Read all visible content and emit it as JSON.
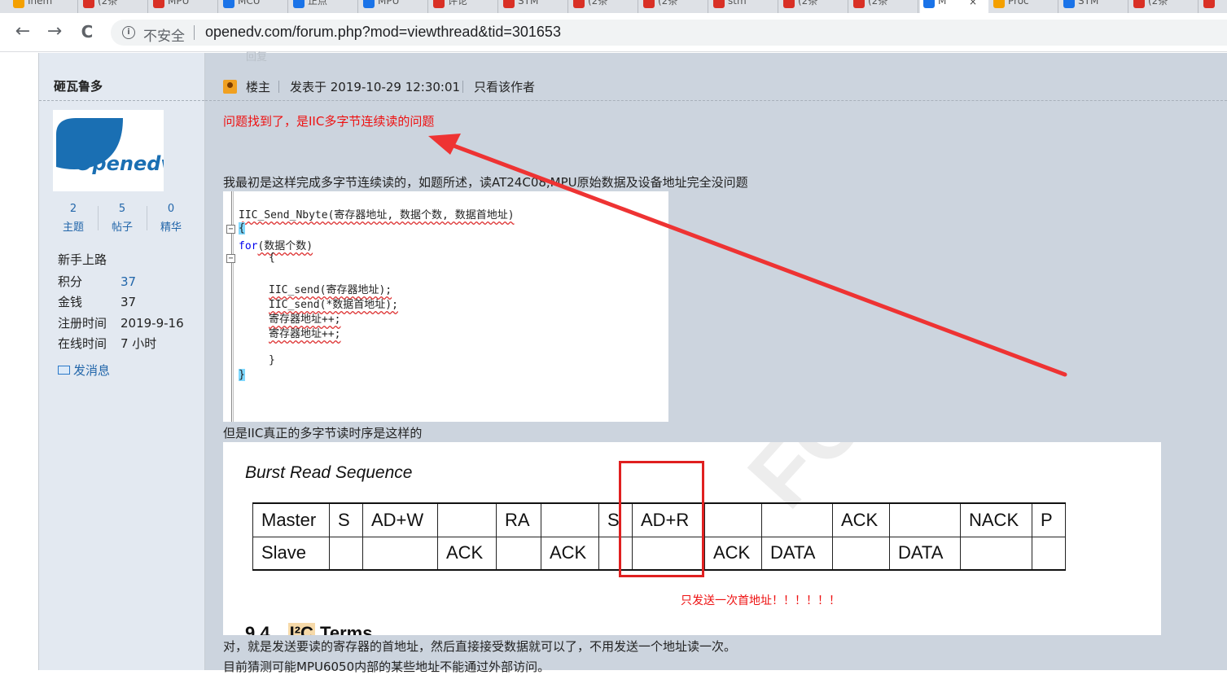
{
  "browser": {
    "tabs": [
      {
        "label": "Inem",
        "color": "#f4a000",
        "active": false
      },
      {
        "label": "(2条",
        "color": "#d93025",
        "active": false
      },
      {
        "label": "MPU",
        "color": "#d93025",
        "active": false
      },
      {
        "label": "MCU",
        "color": "#1a73e8",
        "active": false
      },
      {
        "label": "正点",
        "color": "#1a73e8",
        "active": false
      },
      {
        "label": "MPU",
        "color": "#1a73e8",
        "active": false
      },
      {
        "label": "评论",
        "color": "#d93025",
        "active": false
      },
      {
        "label": "STM",
        "color": "#d93025",
        "active": false
      },
      {
        "label": "(2条",
        "color": "#d93025",
        "active": false
      },
      {
        "label": "(2条",
        "color": "#d93025",
        "active": false
      },
      {
        "label": "stm",
        "color": "#d93025",
        "active": false
      },
      {
        "label": "(2条",
        "color": "#d93025",
        "active": false
      },
      {
        "label": "(2条",
        "color": "#d93025",
        "active": false
      },
      {
        "label": "M",
        "color": "#1a73e8",
        "active": true
      },
      {
        "label": "Proc",
        "color": "#f4a000",
        "active": false
      },
      {
        "label": "STM",
        "color": "#1a73e8",
        "active": false
      },
      {
        "label": "(2条",
        "color": "#d93025",
        "active": false
      },
      {
        "label": "",
        "color": "#d93025",
        "active": false
      }
    ],
    "close_glyph": "×",
    "nav": {
      "back": "←",
      "forward": "→",
      "reload": "C"
    },
    "security_label": "不安全",
    "url": "openedv.com/forum.php?mod=viewthread&tid=301653"
  },
  "top_strip_ghost": "回复",
  "author": {
    "name": "砸瓦鲁多",
    "avatar_text": "Openedv",
    "stats": [
      {
        "value": "2",
        "label": "主题"
      },
      {
        "value": "5",
        "label": "帖子"
      },
      {
        "value": "0",
        "label": "精华"
      }
    ],
    "group": "新手上路",
    "info": [
      {
        "key": "积分",
        "value": "37",
        "link": true
      },
      {
        "key": "金钱",
        "value": "37",
        "link": false
      },
      {
        "key": "注册时间",
        "value": "2019-9-16",
        "link": false
      },
      {
        "key": "在线时间",
        "value": "7 小时",
        "link": false
      }
    ],
    "send_message": "发消息"
  },
  "post": {
    "op_label": "楼主",
    "time": "发表于 2019-10-29 12:30:01",
    "only_author": "只看该作者",
    "line1": "问题找到了，是IIC多字节连续读的问题",
    "line2": "我最初是这样完成多字节连续读的，如题所述，读AT24C08,MPU原始数据及设备地址完全没问题",
    "line3": "但是IIC真正的多字节读时序是这样的",
    "line4": "对，就是发送要读的寄存器的首地址，然后直接接受数据就可以了，不用发送一个地址读一次。",
    "line5": "目前猜测可能MPU6050内部的某些地址不能通过外部访问。"
  },
  "code": {
    "lines": [
      "IIC_Send_Nbyte(寄存器地址, 数据个数, 数据首地址)",
      "{",
      "for(数据个数)",
      "{",
      "IIC_send(寄存器地址);",
      "IIC_send(*数据首地址);",
      "寄存器地址++;",
      "寄存器地址++;",
      "}",
      "}"
    ],
    "fold_minus": "−"
  },
  "timing": {
    "title": "Burst Read Sequence",
    "watermark": "FORMAT",
    "master_row": [
      "Master",
      "S",
      "AD+W",
      "",
      "RA",
      "",
      "S",
      "AD+R",
      "",
      "",
      "ACK",
      "",
      "NACK",
      "P"
    ],
    "slave_row": [
      "Slave",
      "",
      "",
      "ACK",
      "",
      "ACK",
      "",
      "",
      "ACK",
      "DATA",
      "",
      "DATA",
      "",
      ""
    ],
    "annotation": "只发送一次首地址！！！！！！",
    "section_num": "9.4",
    "section_i2c": "I²C",
    "section_title": "Terms"
  },
  "colors": {
    "sidebar_bg": "#e3e9f1",
    "post_bg": "#ccd4de",
    "red_text": "#ee1111",
    "link": "#2266aa",
    "arrow": "#ee3333"
  }
}
